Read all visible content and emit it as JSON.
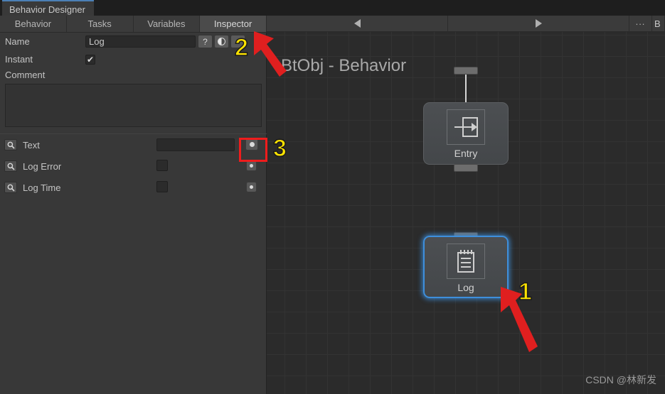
{
  "window": {
    "dock_tab_label": "Behavior Designer",
    "accent_color": "#4b7fb5"
  },
  "inspector": {
    "tabs": [
      {
        "label": "Behavior",
        "active": false
      },
      {
        "label": "Tasks",
        "active": false
      },
      {
        "label": "Variables",
        "active": false
      },
      {
        "label": "Inspector",
        "active": true
      }
    ],
    "fields": {
      "name_label": "Name",
      "name_value": "Log",
      "help_icon": "?",
      "instant_label": "Instant",
      "instant_checked": "✔",
      "comment_label": "Comment",
      "comment_value": ""
    },
    "variables": [
      {
        "label": "Text",
        "control": "text",
        "value": "",
        "magnifier_icon": "search-icon",
        "picker_icon": "object-picker-icon"
      },
      {
        "label": "Log Error",
        "control": "checkbox",
        "value": "",
        "magnifier_icon": "search-icon",
        "picker_icon": "object-picker-icon"
      },
      {
        "label": "Log Time",
        "control": "checkbox",
        "value": "",
        "magnifier_icon": "search-icon",
        "picker_icon": "object-picker-icon"
      }
    ]
  },
  "graph": {
    "toolbar": {
      "back_icon": "triangle-left-icon",
      "forward_icon": "triangle-right-icon",
      "overflow_label": "...",
      "edge_label": "B"
    },
    "title": "BtObj - Behavior",
    "nodes": [
      {
        "id": "entry",
        "label": "Entry",
        "icon": "enter-arrow-icon",
        "selected": false
      },
      {
        "id": "log",
        "label": "Log",
        "icon": "notepad-icon",
        "selected": true
      }
    ],
    "watermark": "CSDN @林新发"
  },
  "annotations": {
    "markers": [
      {
        "id": "marker-1",
        "text": "1"
      },
      {
        "id": "marker-2",
        "text": "2"
      },
      {
        "id": "marker-3",
        "text": "3"
      }
    ],
    "marker_color": "#ffe400",
    "arrow_color": "#e01f1f",
    "highlight_color": "#ef1c1c"
  }
}
